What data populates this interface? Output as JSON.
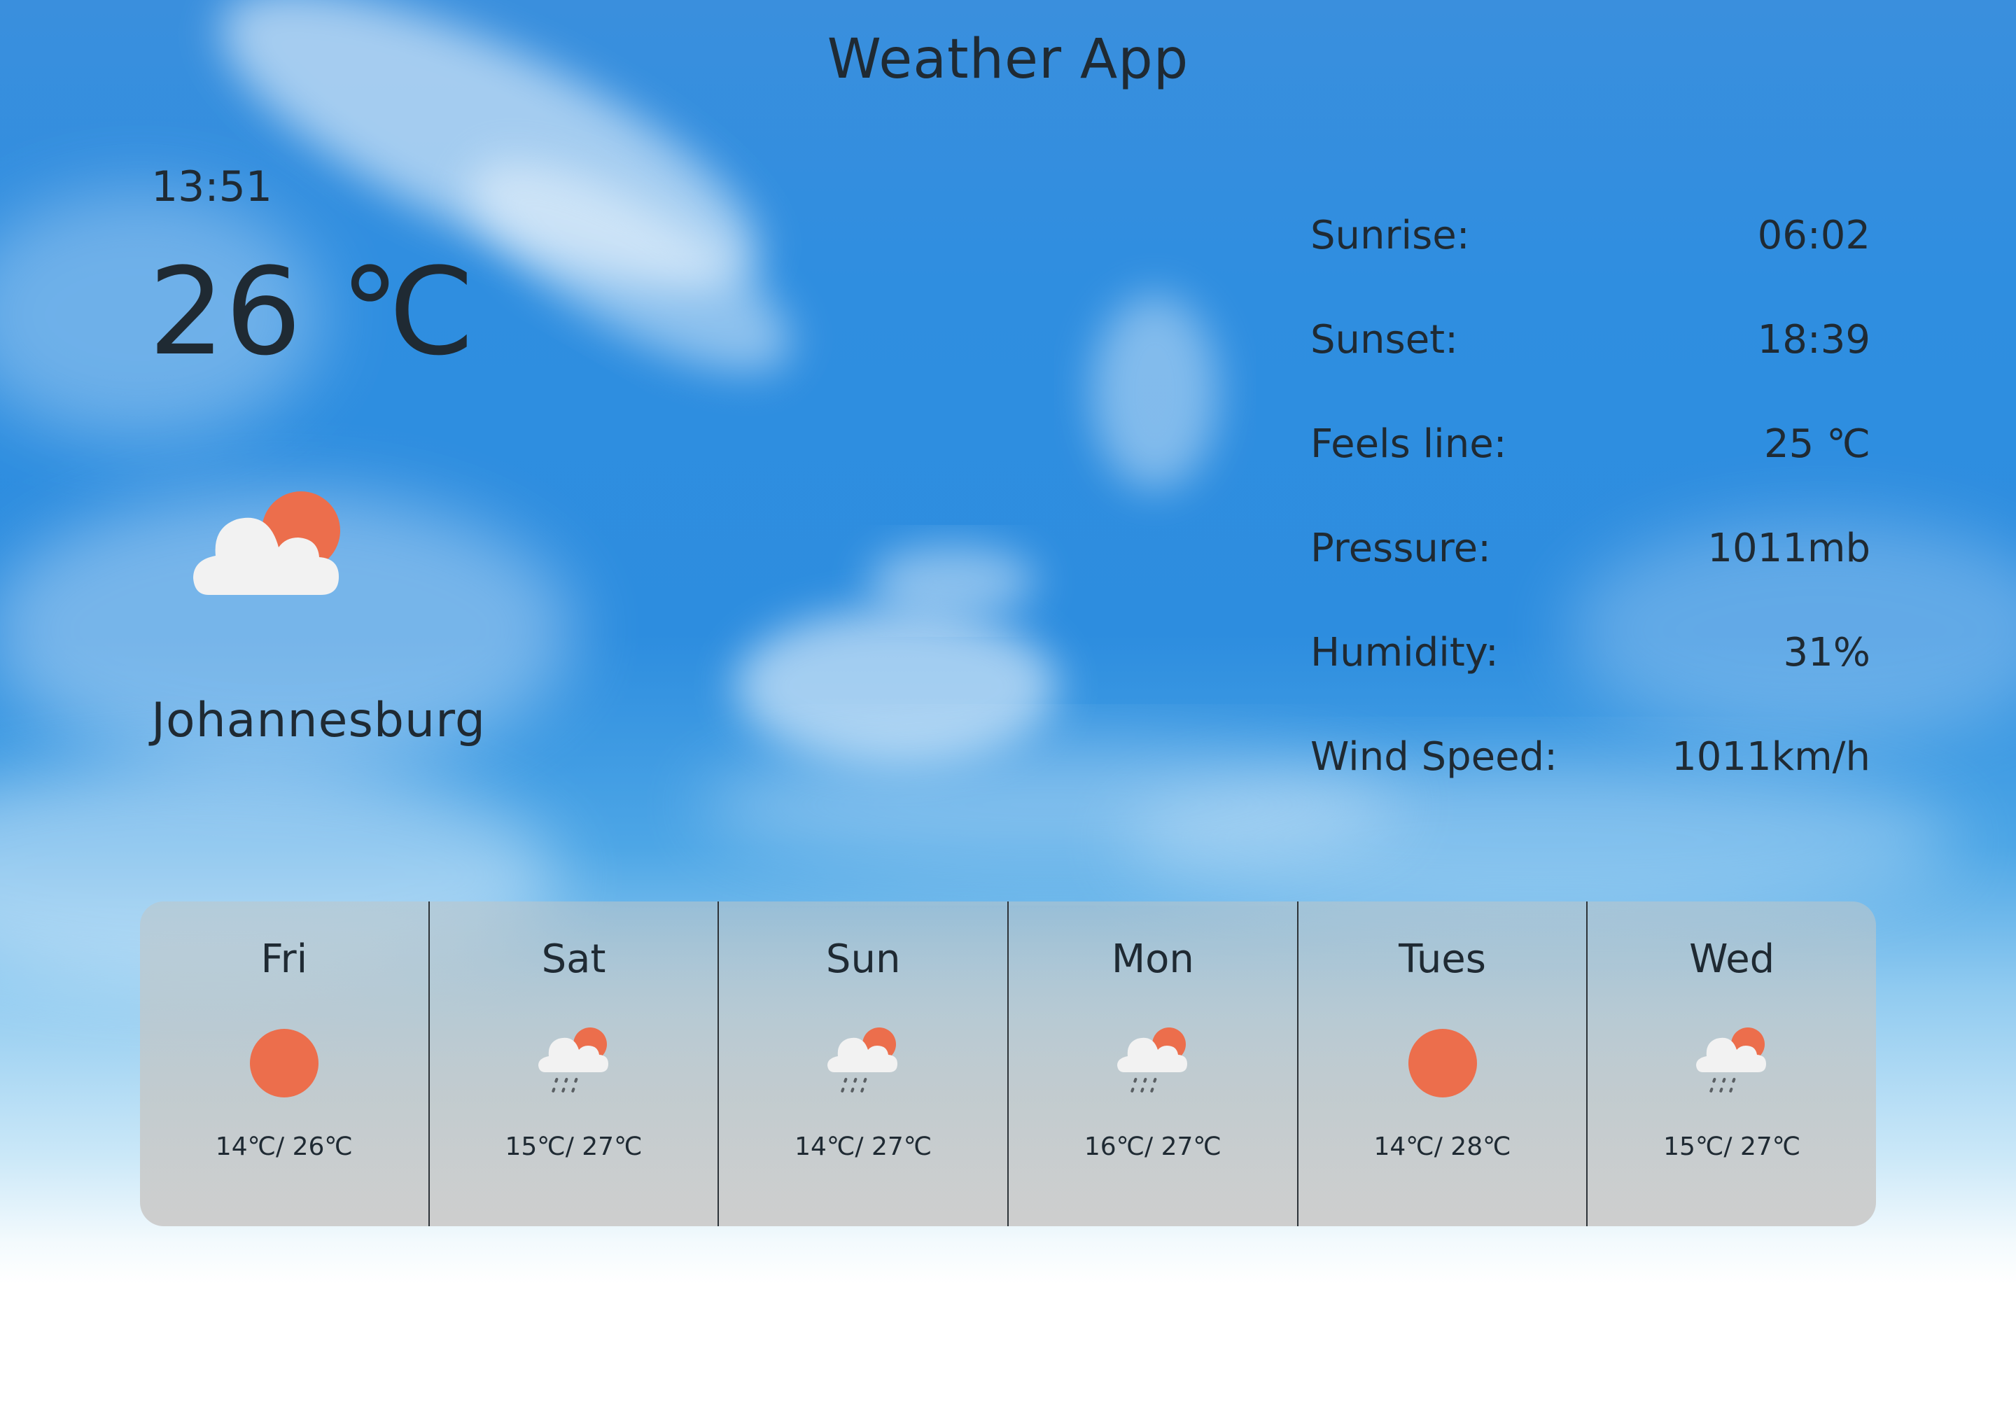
{
  "app": {
    "title": "Weather App"
  },
  "current": {
    "time": "13:51",
    "temperature": "26 ℃",
    "icon": "partly-cloudy-icon",
    "city": "Johannesburg"
  },
  "details": [
    {
      "label": "Sunrise:",
      "value": "06:02"
    },
    {
      "label": "Sunset:",
      "value": "18:39"
    },
    {
      "label": "Feels line:",
      "value": "25 ℃"
    },
    {
      "label": "Pressure:",
      "value": "1011mb"
    },
    {
      "label": "Humidity:",
      "value": "31%"
    },
    {
      "label": "Wind Speed:",
      "value": "1011km/h"
    }
  ],
  "forecast": [
    {
      "day": "Fri",
      "icon": "sun-icon",
      "temps": "14℃/ 26℃"
    },
    {
      "day": "Sat",
      "icon": "rain-cloud-sun-icon",
      "temps": "15℃/ 27℃"
    },
    {
      "day": "Sun",
      "icon": "rain-cloud-sun-icon",
      "temps": "14℃/ 27℃"
    },
    {
      "day": "Mon",
      "icon": "rain-cloud-sun-icon",
      "temps": "16℃/ 27℃"
    },
    {
      "day": "Tues",
      "icon": "sun-icon",
      "temps": "14℃/ 28℃"
    },
    {
      "day": "Wed",
      "icon": "rain-cloud-sun-icon",
      "temps": "15℃/ 27℃"
    }
  ],
  "colors": {
    "sun": "#ec6e4c",
    "cloud": "#f2f2f2",
    "text": "#1f2a33",
    "sky": "#2d8ddf"
  }
}
